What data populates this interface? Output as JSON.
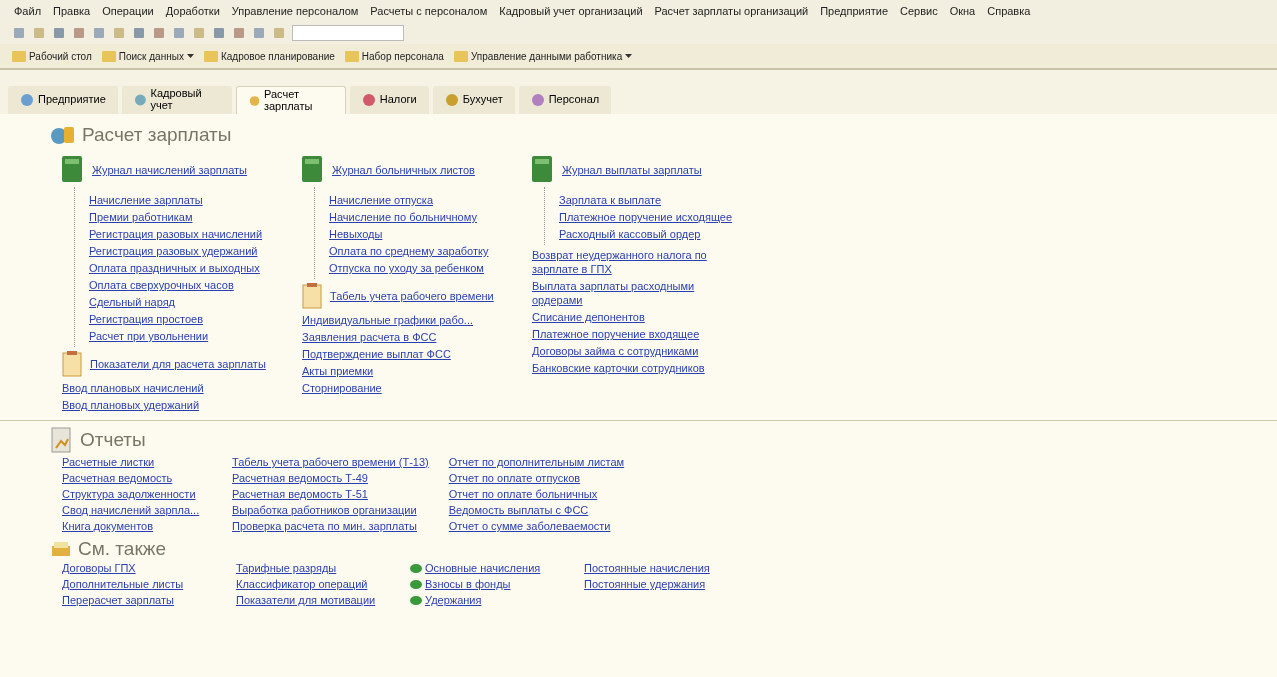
{
  "menu_bar": [
    "Файл",
    "Правка",
    "Операции",
    "Доработки",
    "Управление персоналом",
    "Расчеты с персоналом",
    "Кадровый учет организаций",
    "Расчет зарплаты организаций",
    "Предприятие",
    "Сервис",
    "Окна",
    "Справка"
  ],
  "quick_bar": [
    {
      "label": "Рабочий стол",
      "dropdown": false
    },
    {
      "label": "Поиск данных",
      "dropdown": true
    },
    {
      "label": "Кадровое планирование",
      "dropdown": false
    },
    {
      "label": "Набор персонала",
      "dropdown": false
    },
    {
      "label": "Управление данными работника",
      "dropdown": true
    }
  ],
  "tabs": [
    {
      "label": "Предприятие",
      "selected": false
    },
    {
      "label": "Кадровый учет",
      "selected": false
    },
    {
      "label": "Расчет зарплаты",
      "selected": true
    },
    {
      "label": "Налоги",
      "selected": false
    },
    {
      "label": "Бухучет",
      "selected": false
    },
    {
      "label": "Персонал",
      "selected": false
    }
  ],
  "payroll": {
    "title": "Расчет зарплаты",
    "columns": [
      [
        {
          "kind": "journal",
          "label": "Журнал начислений зарплаты",
          "children": [
            "Начисление зарплаты",
            "Премии работникам",
            "Регистрация разовых начислений",
            "Регистрация разовых удержаний",
            "Оплата праздничных и выходных",
            "Оплата сверхурочных часов",
            "Сдельный наряд",
            "Регистрация простоев",
            "Расчет при увольнении"
          ]
        },
        {
          "kind": "doc",
          "label": "Показатели для расчета зарплаты"
        },
        {
          "kind": "link",
          "label": "Ввод плановых начислений"
        },
        {
          "kind": "link",
          "label": "Ввод плановых удержаний"
        }
      ],
      [
        {
          "kind": "journal",
          "label": "Журнал больничных листов",
          "children": [
            "Начисление отпуска",
            "Начисление по больничному",
            "Невыходы",
            "Оплата по среднему заработку",
            "Отпуска по уходу за ребенком"
          ]
        },
        {
          "kind": "doc",
          "label": "Табель учета рабочего времени"
        },
        {
          "kind": "link",
          "label": "Индивидуальные графики рабо..."
        },
        {
          "kind": "link",
          "label": "Заявления расчета в ФСС"
        },
        {
          "kind": "link",
          "label": "Подтверждение выплат ФСС"
        },
        {
          "kind": "link",
          "label": "Акты приемки"
        },
        {
          "kind": "link",
          "label": "Сторнирование"
        }
      ],
      [
        {
          "kind": "journal",
          "label": "Журнал выплаты зарплаты",
          "children": [
            "Зарплата к выплате",
            "Платежное поручение исходящее",
            "Расходный кассовый ордер"
          ]
        },
        {
          "kind": "link",
          "label": "Возврат неудержанного налога по зарплате в ГПХ"
        },
        {
          "kind": "link",
          "label": "Выплата зарплаты расходными ордерами"
        },
        {
          "kind": "link",
          "label": "Списание депонентов"
        },
        {
          "kind": "link",
          "label": "Платежное поручение входящее"
        },
        {
          "kind": "link",
          "label": "Договоры займа с сотрудниками"
        },
        {
          "kind": "link",
          "label": "Банковские карточки сотрудников"
        }
      ]
    ]
  },
  "reports": {
    "title": "Отчеты",
    "columns": [
      [
        "Расчетные листки",
        "Расчетная ведомость",
        "Структура задолженности",
        "Свод начислений зарпла...",
        "Книга документов"
      ],
      [
        "Табель учета рабочего времени (Т-13)",
        "Расчетная ведомость Т-49",
        "Расчетная ведомость Т-51",
        "Выработка работников организации",
        "Проверка расчета по мин. зарплаты"
      ],
      [
        "Отчет по дополнительным листам",
        "Отчет по оплате отпусков",
        "Отчет по оплате больничных",
        "Ведомость выплаты с ФСС",
        "Отчет о сумме заболеваемости"
      ]
    ]
  },
  "see_also": {
    "title": "См. также",
    "columns": [
      [
        {
          "kind": "link",
          "label": "Договоры ГПХ"
        },
        {
          "kind": "link",
          "label": "Дополнительные листы"
        },
        {
          "kind": "link",
          "label": "Перерасчет зарплаты"
        }
      ],
      [
        {
          "kind": "link",
          "label": "Тарифные разряды"
        },
        {
          "kind": "link",
          "label": "Классификатор операций"
        },
        {
          "kind": "link",
          "label": "Показатели для мотивации"
        }
      ],
      [
        {
          "kind": "catalog",
          "label": "Основные начисления"
        },
        {
          "kind": "catalog",
          "label": "Взносы в фонды"
        },
        {
          "kind": "catalog",
          "label": "Удержания"
        }
      ],
      [
        {
          "kind": "link",
          "label": "Постоянные начисления"
        },
        {
          "kind": "link",
          "label": "Постоянные удержания"
        }
      ]
    ]
  }
}
